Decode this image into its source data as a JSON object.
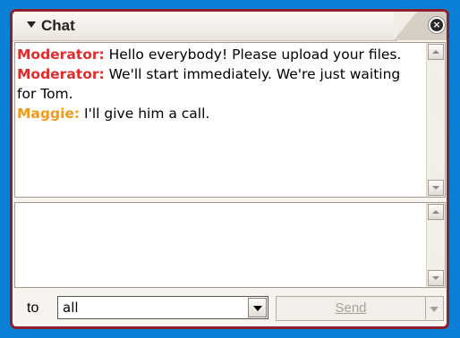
{
  "window": {
    "title": "Chat",
    "colors": {
      "moderator": "#e32b2b",
      "maggie": "#f39a16",
      "frame": "#8f1f2a",
      "background": "#0a7fd6"
    }
  },
  "messages": [
    {
      "sender": "Moderator:",
      "text": " Hello everybody! Please upload your files."
    },
    {
      "sender": "Moderator:",
      "text": " We'll start immediately. We're just waiting for Tom."
    },
    {
      "sender": "Maggie:",
      "text": " I'll give him a call."
    }
  ],
  "compose": {
    "to_label": "to",
    "recipient_value": "all",
    "send_label": "Send"
  },
  "icons": {
    "collapse": "triangle-down-icon",
    "close": "close-icon",
    "scroll_up": "arrow-up-icon",
    "scroll_down": "arrow-down-icon",
    "dropdown": "chevron-down-icon"
  }
}
